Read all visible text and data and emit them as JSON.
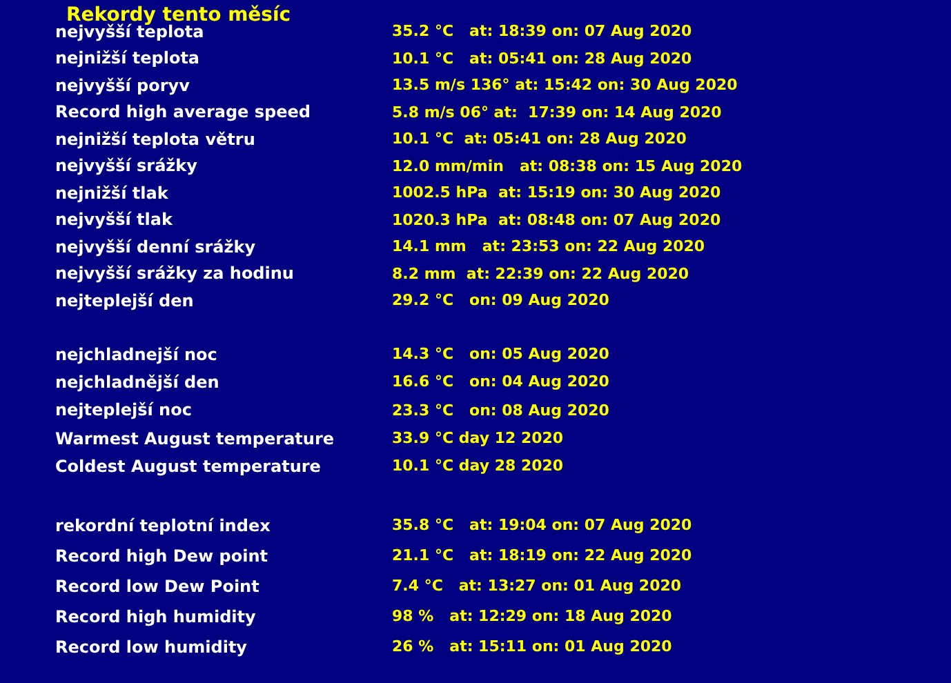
{
  "title": "Rekordy tento měsíc",
  "sections": [
    {
      "rows": [
        {
          "label": "nejvyšší teplota",
          "value": "35.2 °C   at: 18:39 on: 07 Aug 2020"
        },
        {
          "label": "nejnižší teplota",
          "value": "10.1 °C   at: 05:41 on: 28 Aug 2020"
        },
        {
          "label": "nejvyšší poryv",
          "value": "13.5 m/s 136° at: 15:42 on: 30 Aug 2020"
        },
        {
          "label": "Record high average speed",
          "value": "5.8 m/s 06° at:  17:39 on: 14 Aug 2020"
        },
        {
          "label": "nejnižší teplota větru",
          "value": "10.1 °C  at: 05:41 on: 28 Aug 2020"
        },
        {
          "label": "nejvyšší srážky",
          "value": "12.0 mm/min   at: 08:38 on: 15 Aug 2020"
        },
        {
          "label": "nejnižší tlak",
          "value": "1002.5 hPa  at: 15:19 on: 30 Aug 2020"
        },
        {
          "label": "nejvyšší tlak",
          "value": "1020.3 hPa  at: 08:48 on: 07 Aug 2020"
        },
        {
          "label": "nejvyšší denní srážky",
          "value": "14.1 mm   at: 23:53 on: 22 Aug 2020"
        },
        {
          "label": "nejvyšší srážky za hodinu",
          "value": "8.2 mm  at: 22:39 on: 22 Aug 2020"
        },
        {
          "label": "nejteplejší den",
          "value": "29.2 °C   on: 09 Aug 2020"
        }
      ]
    },
    {
      "rows": [
        {
          "label": "nejchladnejší noc",
          "value": "14.3 °C   on: 05 Aug 2020"
        },
        {
          "label": "nejchladnější den",
          "value": "16.6 °C   on: 04 Aug 2020"
        },
        {
          "label": "nejteplejší noc",
          "value": "23.3 °C   on: 08 Aug 2020"
        },
        {
          "label": "Warmest August temperature",
          "value": "33.9 °C day 12 2020"
        },
        {
          "label": "Coldest August temperature",
          "value": "10.1 °C day 28 2020"
        }
      ]
    },
    {
      "rows": [
        {
          "label": "rekordní teplotní index",
          "value": "35.8 °C   at: 19:04 on: 07 Aug 2020"
        },
        {
          "label": "Record high Dew point",
          "value": "21.1 °C   at: 18:19 on: 22 Aug 2020"
        },
        {
          "label": "Record low Dew Point",
          "value": "7.4 °C   at: 13:27 on: 01 Aug 2020"
        },
        {
          "label": "Record high humidity",
          "value": "98 %   at: 12:29 on: 18 Aug 2020"
        },
        {
          "label": "Record low humidity",
          "value": "26 %   at: 15:11 on: 01 Aug 2020"
        }
      ]
    }
  ]
}
